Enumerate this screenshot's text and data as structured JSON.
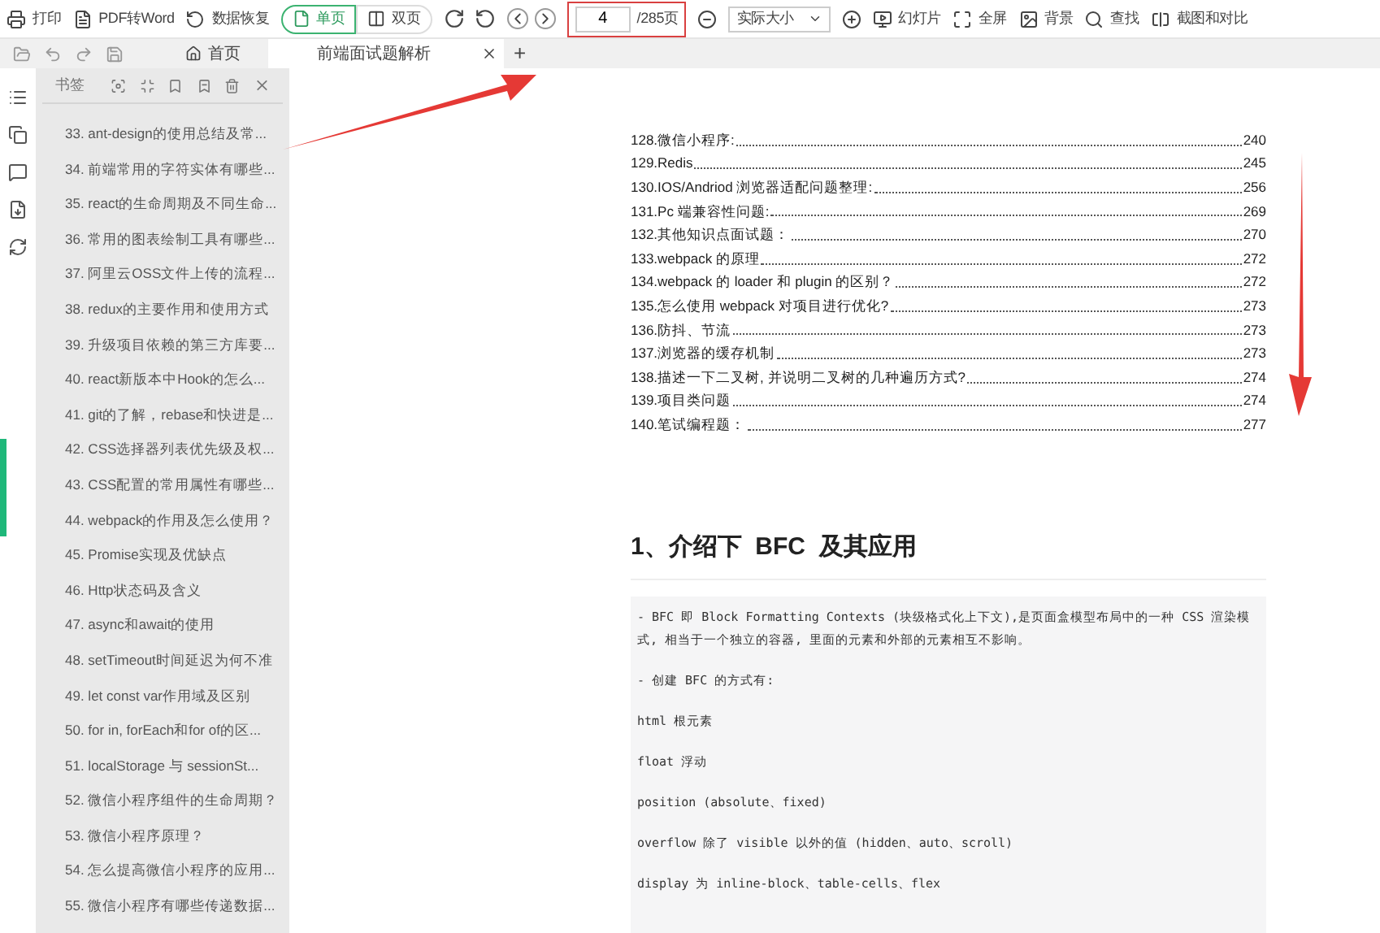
{
  "toolbar": {
    "buttons": [
      {
        "label": "打印"
      },
      {
        "label": "PDF转Word"
      },
      {
        "label": "数据恢复"
      }
    ],
    "view_modes": [
      {
        "label": "单页",
        "selected": true
      },
      {
        "label": "双页",
        "selected": false
      }
    ],
    "page_field": {
      "value": "4",
      "total": "/285页"
    },
    "zoom_select": {
      "value": "实际大小"
    },
    "tools": [
      {
        "label": "幻灯片"
      },
      {
        "label": "全屏"
      },
      {
        "label": "背景"
      },
      {
        "label": "查找"
      },
      {
        "label": "截图和对比"
      }
    ]
  },
  "tabs": [
    {
      "label": "首页",
      "selected": false,
      "closable": false
    },
    {
      "label": "前端面试题解析",
      "selected": true,
      "closable": true
    }
  ],
  "new_tab": "+",
  "bookmarks": {
    "title": "书签",
    "items": [
      "33. ant-design的使用总结及常...",
      "34. 前端常用的字符实体有哪些...",
      "35. react的生命周期及不同生命...",
      "36. 常用的图表绘制工具有哪些...",
      "37. 阿里云OSS文件上传的流程...",
      "38. redux的主要作用和使用方式",
      "39. 升级项目依赖的第三方库要...",
      "40. react新版本中Hook的怎么...",
      "41. git的了解，rebase和快进是...",
      "42. CSS选择器列表优先级及权...",
      "43. CSS配置的常用属性有哪些...",
      "44. webpack的作用及怎么使用？",
      "45. Promise实现及优缺点",
      "46. Http状态码及含义",
      "47. async和await的使用",
      "48. setTimeout时间延迟为何不准",
      "49. let const var作用域及区别",
      "50. for in, forEach和for of的区...",
      "51. localStorage 与 sessionSt...",
      "52. 微信小程序组件的生命周期？",
      "53. 微信小程序原理？",
      "54. 怎么提高微信小程序的应用...",
      "55. 微信小程序有哪些传递数据..."
    ]
  },
  "document": {
    "toc": [
      {
        "title": "128.微信小程序:",
        "page": "240"
      },
      {
        "title": "129.Redis",
        "page": "245"
      },
      {
        "title": "130.IOS/Andriod 浏览器适配问题整理:",
        "page": "256"
      },
      {
        "title": "131.Pc 端兼容性问题:",
        "page": "269"
      },
      {
        "title": "132.其他知识点面试题：",
        "page": "270"
      },
      {
        "title": "133.webpack 的原理",
        "page": "272"
      },
      {
        "title": "134.webpack 的 loader 和 plugin 的区别？",
        "page": "272"
      },
      {
        "title": "135.怎么使用 webpack 对项目进行优化?",
        "page": "273"
      },
      {
        "title": "136.防抖、节流",
        "page": "273"
      },
      {
        "title": "137.浏览器的缓存机制",
        "page": "273"
      },
      {
        "title": "138.描述一下二叉树, 并说明二叉树的几种遍历方式?",
        "page": "274"
      },
      {
        "title": "139.项目类问题",
        "page": "274"
      },
      {
        "title": "140.笔试编程题：",
        "page": "277"
      }
    ],
    "heading": "1、介绍下  BFC  及其应用",
    "code_lines": [
      "- BFC 即 Block Formatting Contexts (块级格式化上下文),是页面盒模型布局中的一种 CSS 渲染模式, 相当于一个独立的容器, 里面的元素和外部的元素相互不影响。",
      "- 创建 BFC 的方式有:",
      "html 根元素",
      "float 浮动",
      "position (absolute、fixed)",
      "overflow 除了 visible 以外的值 (hidden、auto、scroll)",
      "display 为 inline-block、table-cells、flex"
    ]
  }
}
